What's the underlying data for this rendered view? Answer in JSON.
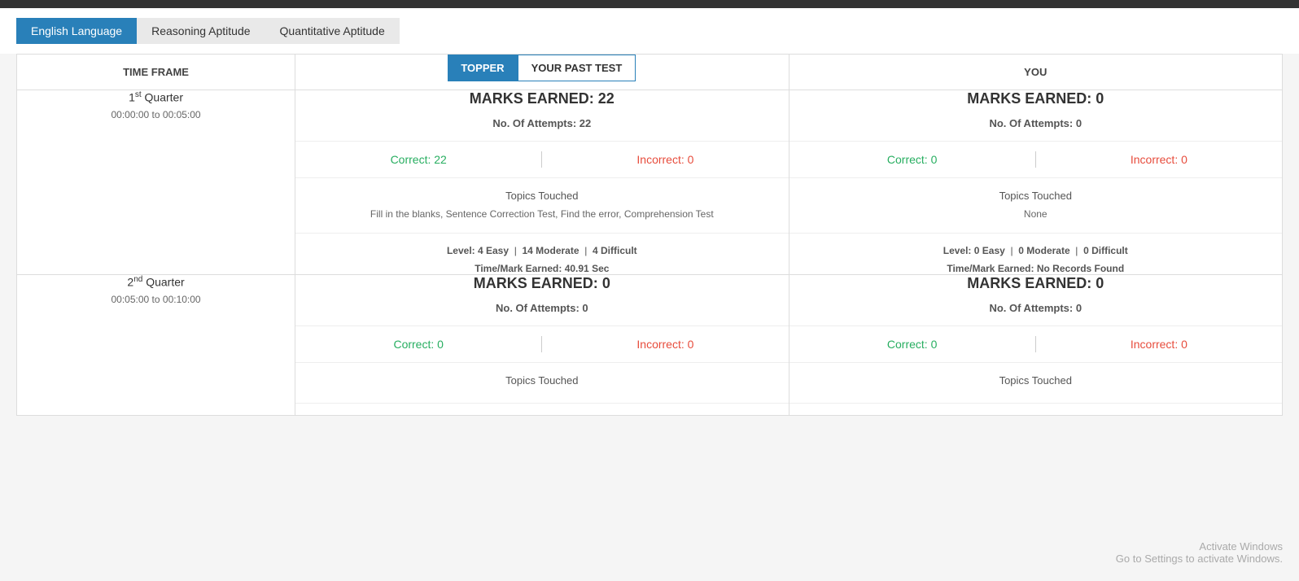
{
  "topbar": {
    "background": "#333"
  },
  "nav": {
    "tabs": [
      {
        "label": "English Language",
        "active": true
      },
      {
        "label": "Reasoning Aptitude",
        "active": false
      },
      {
        "label": "Quantitative Aptitude",
        "active": false
      }
    ]
  },
  "table": {
    "col_timeframe": "TIME FRAME",
    "col_topper": "TOPPER",
    "col_your_past_test": "YOUR PAST TEST",
    "col_you": "YOU",
    "rows": [
      {
        "quarter": "1",
        "quarter_suffix": "st",
        "quarter_label": "Quarter",
        "time_start": "00:00:00",
        "time_end": "00:05:00",
        "topper": {
          "marks_earned_label": "MARKS EARNED:",
          "marks_earned_value": "22",
          "attempts_label": "No. Of Attempts:",
          "attempts_value": "22",
          "correct_label": "Correct:",
          "correct_value": "22",
          "incorrect_label": "Incorrect:",
          "incorrect_value": "0",
          "topics_title": "Topics Touched",
          "topics_content": "Fill in the blanks, Sentence Correction Test, Find the error, Comprehension Test",
          "level_label": "Level:",
          "level_easy": "4 Easy",
          "level_moderate": "14 Moderate",
          "level_difficult": "4 Difficult",
          "time_mark_label": "Time/Mark Earned:",
          "time_mark_value": "40.91 Sec"
        },
        "you": {
          "marks_earned_label": "MARKS EARNED:",
          "marks_earned_value": "0",
          "attempts_label": "No. Of Attempts:",
          "attempts_value": "0",
          "correct_label": "Correct:",
          "correct_value": "0",
          "incorrect_label": "Incorrect:",
          "incorrect_value": "0",
          "topics_title": "Topics Touched",
          "topics_content": "None",
          "level_label": "Level:",
          "level_easy": "0 Easy",
          "level_moderate": "0 Moderate",
          "level_difficult": "0 Difficult",
          "time_mark_label": "Time/Mark Earned:",
          "time_mark_value": "No Records Found"
        }
      },
      {
        "quarter": "2",
        "quarter_suffix": "nd",
        "quarter_label": "Quarter",
        "time_start": "00:05:00",
        "time_end": "00:10:00",
        "topper": {
          "marks_earned_label": "MARKS EARNED:",
          "marks_earned_value": "0",
          "attempts_label": "No. Of Attempts:",
          "attempts_value": "0",
          "correct_label": "Correct:",
          "correct_value": "0",
          "incorrect_label": "Incorrect:",
          "incorrect_value": "0",
          "topics_title": "Topics Touched",
          "topics_content": ""
        },
        "you": {
          "marks_earned_label": "MARKS EARNED:",
          "marks_earned_value": "0",
          "attempts_label": "No. Of Attempts:",
          "attempts_value": "0",
          "correct_label": "Correct:",
          "correct_value": "0",
          "incorrect_label": "Incorrect:",
          "incorrect_value": "0",
          "topics_title": "Topics Touched",
          "topics_content": ""
        }
      }
    ]
  },
  "activate": {
    "line1": "Activate Windows",
    "line2": "Go to Settings to activate Windows."
  }
}
